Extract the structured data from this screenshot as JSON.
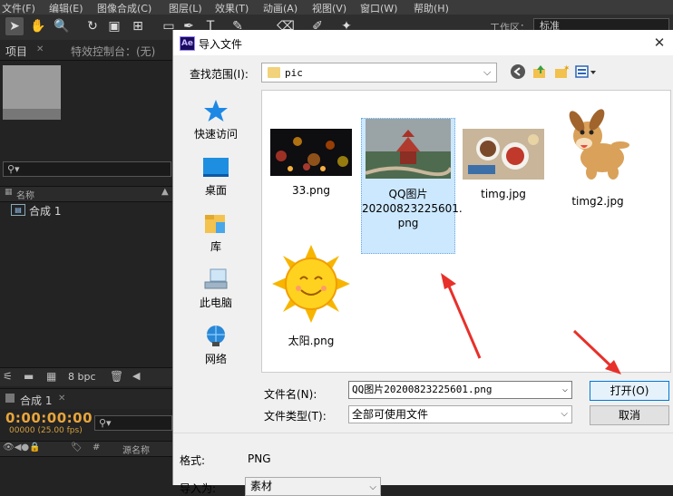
{
  "menubar": {
    "items": [
      "文件(F)",
      "编辑(E)",
      "图像合成(C)",
      "图层(L)",
      "效果(T)",
      "动画(A)",
      "视图(V)",
      "窗口(W)",
      "帮助(H)"
    ]
  },
  "toolbar": {
    "workspace_label": "工作区：",
    "workspace_value": "标准"
  },
  "project_panel": {
    "tab_project": "项目",
    "tab_effects": "特效控制台：(无)",
    "column_name": "名称",
    "comp_name": "合成 1",
    "bit_depth": "8 bpc"
  },
  "timeline_panel": {
    "tab": "合成 1",
    "timecode": "0:00:00:00",
    "fps": "00000 (25.00 fps)",
    "column_source": "源名称"
  },
  "dialog": {
    "title": "导入文件",
    "lookin_label": "查找范围(I):",
    "lookin_value": "pic",
    "places": [
      "快速访问",
      "桌面",
      "库",
      "此电脑",
      "网络"
    ],
    "files": [
      {
        "name": "33.png",
        "selected": false
      },
      {
        "name": "QQ图片20200823225601.png",
        "name_lines": [
          "QQ图片",
          "20200823225601.",
          "png"
        ],
        "selected": true
      },
      {
        "name": "timg.jpg",
        "selected": false
      },
      {
        "name": "timg2.jpg",
        "selected": false
      },
      {
        "name": "太阳.png",
        "selected": false
      }
    ],
    "filename_label": "文件名(N):",
    "filename_value": "QQ图片20200823225601.png",
    "filetype_label": "文件类型(T):",
    "filetype_value": "全部可使用文件",
    "open_button": "打开(O)",
    "cancel_button": "取消",
    "format_label": "格式:",
    "format_value": "PNG",
    "importas_label": "导入为:",
    "importas_value": "素材"
  },
  "colors": {
    "accent": "#0078d7",
    "selection": "#cce8ff",
    "timecode": "#e8a53b",
    "arrow": "#e8302a"
  }
}
